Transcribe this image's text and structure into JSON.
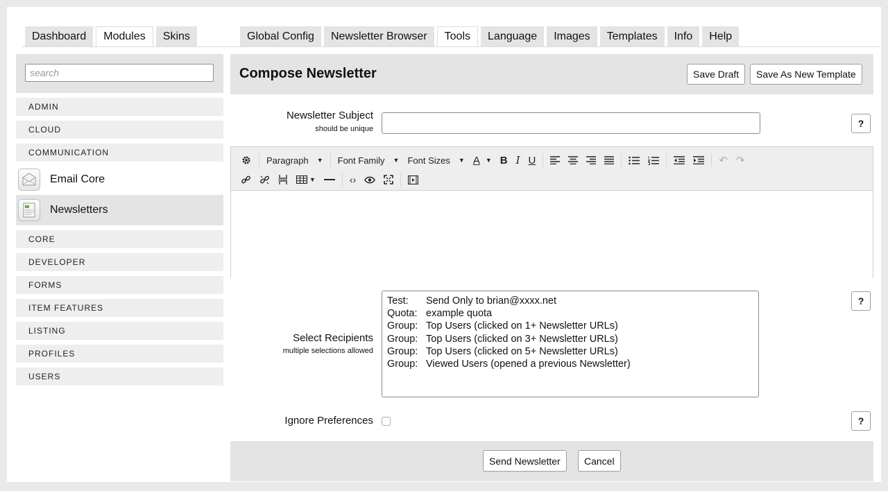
{
  "tabs_left": [
    "Dashboard",
    "Modules",
    "Skins"
  ],
  "tabs_left_active": "Modules",
  "tabs_right": [
    "Global Config",
    "Newsletter Browser",
    "Tools",
    "Language",
    "Images",
    "Templates",
    "Info",
    "Help"
  ],
  "tabs_right_active": "Tools",
  "sidebar": {
    "search_placeholder": "search",
    "cats_top": [
      "ADMIN",
      "CLOUD",
      "COMMUNICATION"
    ],
    "modules": [
      {
        "label": "Email Core",
        "icon": "envelope-icon"
      },
      {
        "label": "Newsletters",
        "icon": "newsletter-icon"
      }
    ],
    "cats_bottom": [
      "CORE",
      "DEVELOPER",
      "FORMS",
      "ITEM FEATURES",
      "LISTING",
      "PROFILES",
      "USERS"
    ]
  },
  "main": {
    "title": "Compose Newsletter",
    "save_draft": "Save Draft",
    "save_template": "Save As New Template",
    "subject_label": "Newsletter Subject",
    "subject_hint": "should be unique",
    "subject_value": "",
    "help_label": "?",
    "toolbar": {
      "block_format": "Paragraph",
      "font_family": "Font Family",
      "font_sizes": "Font Sizes"
    },
    "recipients_label": "Select Recipients",
    "recipients_hint": "multiple selections allowed",
    "recipients": [
      {
        "key": "Test:",
        "text": "Send Only to brian@xxxx.net"
      },
      {
        "key": "Quota:",
        "text": "example quota"
      },
      {
        "key": "Group:",
        "text": "Top Users (clicked on 1+ Newsletter URLs)"
      },
      {
        "key": "Group:",
        "text": "Top Users (clicked on 3+ Newsletter URLs)"
      },
      {
        "key": "Group:",
        "text": "Top Users (clicked on 5+ Newsletter URLs)"
      },
      {
        "key": "Group:",
        "text": "Viewed Users (opened a previous Newsletter)"
      }
    ],
    "ignore_label": "Ignore Preferences",
    "send_label": "Send Newsletter",
    "cancel_label": "Cancel"
  }
}
